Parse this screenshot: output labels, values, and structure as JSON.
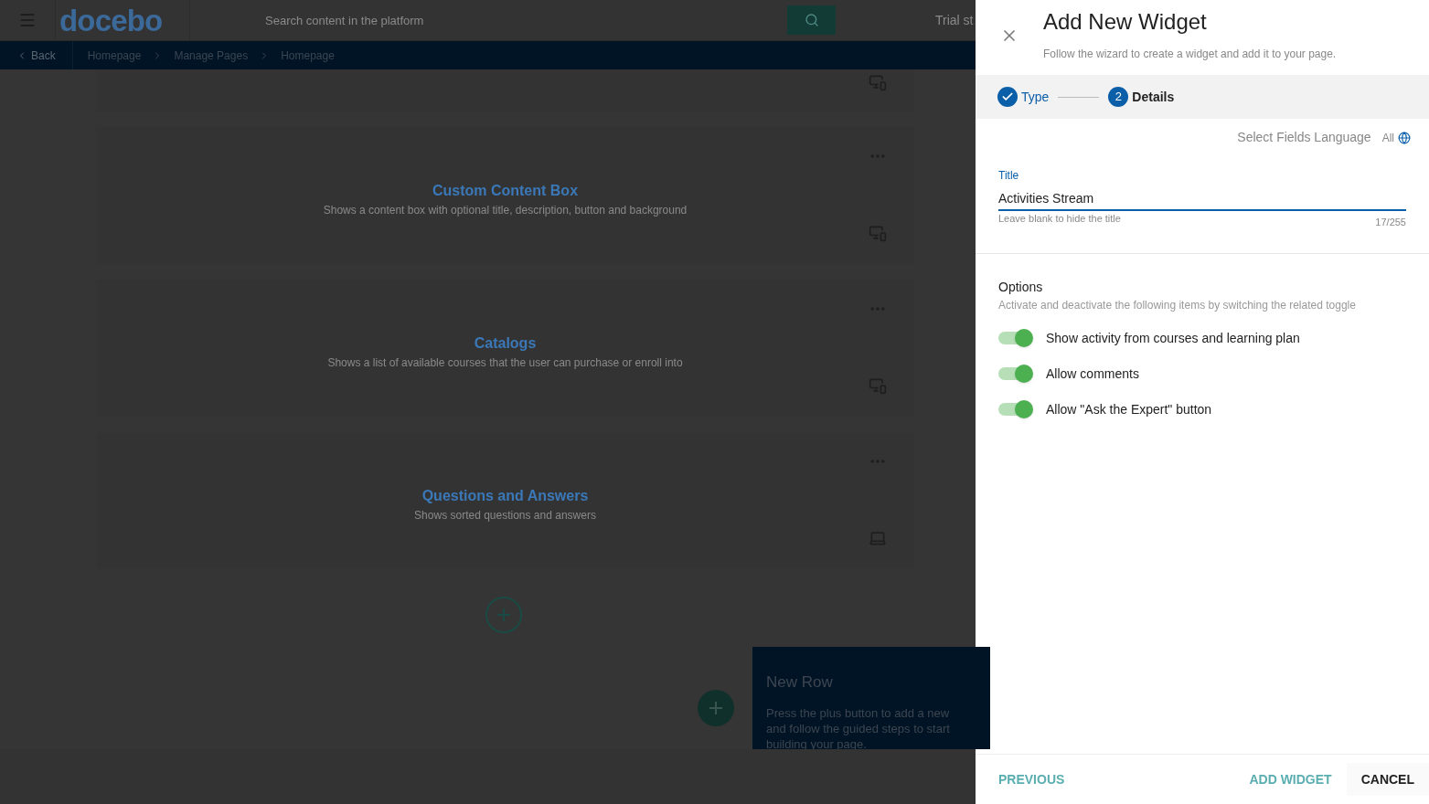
{
  "header": {
    "logo": "docebo",
    "search": {
      "placeholder": "Search content in the platform"
    },
    "trial": "Trial st"
  },
  "breadcrumb": {
    "back": "Back",
    "items": [
      "Homepage",
      "Manage Pages",
      "Homepage"
    ]
  },
  "widgets": [
    {
      "kind": "partial"
    },
    {
      "kind": "responsive",
      "title": "Custom Content Box",
      "description": "Shows a content box with optional title, description, button and background"
    },
    {
      "kind": "responsive",
      "title": "Catalogs",
      "description": "Shows a list of available courses that the user can purchase or enroll into"
    },
    {
      "kind": "desktop",
      "title": "Questions and Answers",
      "description": "Shows sorted questions and answers"
    }
  ],
  "tooltip": {
    "title": "New Row",
    "lines": [
      "Press the plus button to add a new",
      "and follow the guided steps to start",
      "building your page."
    ]
  },
  "panel": {
    "title": "Add New Widget",
    "subtitle": "Follow the wizard to create a widget and add it to your page.",
    "steps": [
      {
        "label": "Type",
        "done": true,
        "selected": false
      },
      {
        "label": "Details",
        "number": "2",
        "done": false,
        "selected": true
      }
    ],
    "language": {
      "label": "Select Fields Language",
      "value": "All"
    },
    "field": {
      "label": "Title",
      "value": "Activities Stream",
      "hint": "Leave blank to hide the title",
      "counter": "17/255"
    },
    "options": {
      "heading": "Options",
      "description": "Activate and deactivate the following items by switching the related toggle",
      "toggles": [
        {
          "label": "Show activity from courses and learning plan",
          "on": true
        },
        {
          "label": "Allow comments",
          "on": true
        },
        {
          "label": "Allow \"Ask the Expert\" button",
          "on": true
        }
      ]
    },
    "buttons": {
      "previous": "PREVIOUS",
      "add": "ADD WIDGET",
      "cancel": "CANCEL"
    }
  }
}
